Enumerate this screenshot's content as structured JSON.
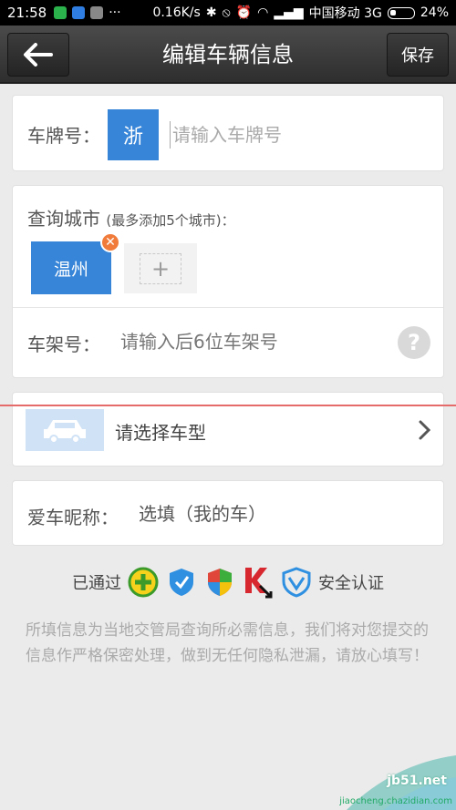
{
  "status_bar": {
    "time": "21:58",
    "net_speed": "0.16K/s",
    "carrier": "中国移动 3G",
    "battery": "24%"
  },
  "header": {
    "title": "编辑车辆信息",
    "save_label": "保存"
  },
  "plate": {
    "label": "车牌号：",
    "province": "浙",
    "placeholder": "请输入车牌号"
  },
  "city": {
    "label": "查询城市",
    "hint": "(最多添加5个城市)：",
    "cities": [
      "温州"
    ],
    "add_symbol": "+"
  },
  "vin": {
    "label": "车架号：",
    "placeholder": "请输入后6位车架号",
    "help_symbol": "?"
  },
  "model": {
    "label": "请选择车型"
  },
  "nickname": {
    "label": "爱车昵称：",
    "placeholder": "选填（我的车）"
  },
  "security": {
    "prefix": "已通过",
    "suffix": "安全认证",
    "icons": [
      "360-icon",
      "tencent-shield-icon",
      "windows-shield-icon",
      "kaspersky-icon",
      "baidu-shield-icon"
    ]
  },
  "disclaimer": "所填信息为当地交管局查询所必需信息，我们将对您提交的信息作严格保密处理，做到无任何隐私泄漏，请放心填写！",
  "watermark": {
    "site": "jb51.net",
    "sub": "jiaocheng.chazidian.com"
  },
  "colors": {
    "accent": "#3785d8",
    "badge": "#f07b3a",
    "background": "#ebebeb"
  }
}
